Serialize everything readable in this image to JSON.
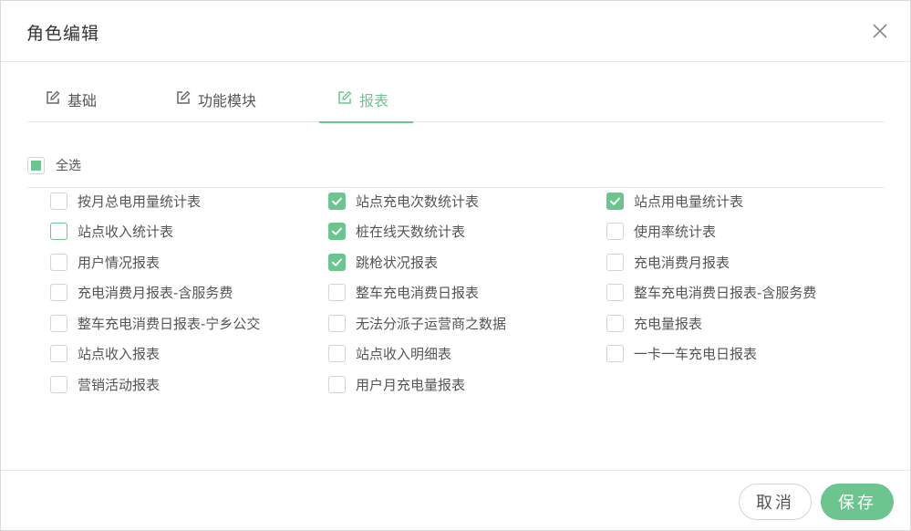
{
  "dialog": {
    "title": "角色编辑",
    "accent_color": "#6cc58f"
  },
  "tabs": [
    {
      "label": "基础",
      "icon": "edit-icon",
      "active": false
    },
    {
      "label": "功能模块",
      "icon": "edit-icon",
      "active": false
    },
    {
      "label": "报表",
      "icon": "edit-icon",
      "active": true
    }
  ],
  "select_all": {
    "label": "全选",
    "state": "indeterminate"
  },
  "reports": [
    {
      "label": "按月总电用量统计表",
      "checked": false
    },
    {
      "label": "站点充电次数统计表",
      "checked": true
    },
    {
      "label": "站点用电量统计表",
      "checked": true
    },
    {
      "label": "站点收入统计表",
      "checked": false
    },
    {
      "label": "桩在线天数统计表",
      "checked": true
    },
    {
      "label": "使用率统计表",
      "checked": false
    },
    {
      "label": "用户情况报表",
      "checked": false
    },
    {
      "label": "跳枪状况报表",
      "checked": true
    },
    {
      "label": "充电消费月报表",
      "checked": false
    },
    {
      "label": "充电消费月报表-含服务费",
      "checked": false
    },
    {
      "label": "整车充电消费日报表",
      "checked": false
    },
    {
      "label": "整车充电消费日报表-含服务费",
      "checked": false
    },
    {
      "label": "整车充电消费日报表-宁乡公交",
      "checked": false
    },
    {
      "label": "无法分派子运营商之数据",
      "checked": false
    },
    {
      "label": "充电量报表",
      "checked": false
    },
    {
      "label": "站点收入报表",
      "checked": false
    },
    {
      "label": "站点收入明细表",
      "checked": false
    },
    {
      "label": "一卡一车充电日报表",
      "checked": false
    },
    {
      "label": "营销活动报表",
      "checked": false
    },
    {
      "label": "用户月充电量报表",
      "checked": false
    }
  ],
  "footer": {
    "cancel_label": "取消",
    "save_label": "保存"
  }
}
